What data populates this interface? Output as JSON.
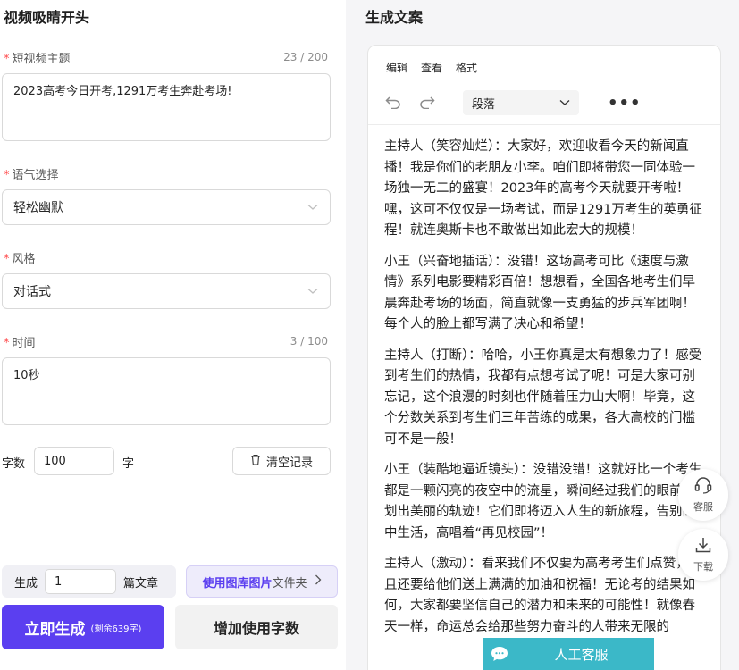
{
  "left": {
    "title": "视频吸睛开头",
    "topic": {
      "label": "短视频主题",
      "counter": "23 / 200",
      "value": "2023高考今日开考,1291万考生奔赴考场!"
    },
    "tone": {
      "label": "语气选择",
      "value": "轻松幽默"
    },
    "style": {
      "label": "风格",
      "value": "对话式"
    },
    "time": {
      "label": "时间",
      "counter": "3 / 100",
      "value": "10秒"
    },
    "word_count": {
      "label": "字数",
      "value": "100",
      "unit": "字"
    },
    "clear_label": "清空记录",
    "generate": {
      "prefix": "生成",
      "count": "1",
      "suffix": "篇文章"
    },
    "library": {
      "main": "使用图库图片",
      "sub": "文件夹"
    },
    "primary": {
      "label": "立即生成",
      "remaining": "(剩余639字)"
    },
    "add_words_label": "增加使用字数"
  },
  "right": {
    "title": "生成文案",
    "menu": [
      "编辑",
      "查看",
      "格式"
    ],
    "paragraph_select": "段落",
    "more": "•••",
    "paragraphs": [
      "主持人（笑容灿烂）：大家好，欢迎收看今天的新闻直播！我是你们的老朋友小李。咱们即将带您一同体验一场独一无二的盛宴！2023年的高考今天就要开考啦！嘿，这可不仅仅是一场考试，而是1291万考生的英勇征程！就连奥斯卡也不敢做出如此宏大的规模！",
      "小王（兴奋地插话）：没错！这场高考可比《速度与激情》系列电影要精彩百倍！想想看，全国各地考生们早晨奔赴考场的场面，简直就像一支勇猛的步兵军团啊！每个人的脸上都写满了决心和希望！",
      "主持人（打断）：哈哈，小王你真是太有想象力了！感受到考生们的热情，我都有点想考试了呢！可是大家可别忘记，这个浪漫的时刻也伴随着压力山大啊！毕竟，这个分数关系到考生们三年苦练的成果，各大高校的门槛可不是一般！",
      "小王（装酷地逼近镜头）：没错没错！这就好比一个考生都是一颗闪亮的夜空中的流星，瞬间经过我们的眼前，划出美丽的轨迹！它们即将迈入人生的新旅程，告别高中生活，高唱着“再见校园”！",
      "主持人（激动）：看来我们不仅要为高考考生们点赞，而且还要给他们送上满满的加油和祝福！无论考的结果如何，大家都要坚信自己的潜力和未来的可能性！就像春天一样，命运总会给那些努力奋斗的人带来无限的"
    ]
  },
  "floating": {
    "service": "客服",
    "download": "下载",
    "live_service": "人工客服"
  },
  "colors": {
    "accent": "#5b3ff0",
    "required": "#ff4d4f",
    "service": "#3bb8c8"
  }
}
